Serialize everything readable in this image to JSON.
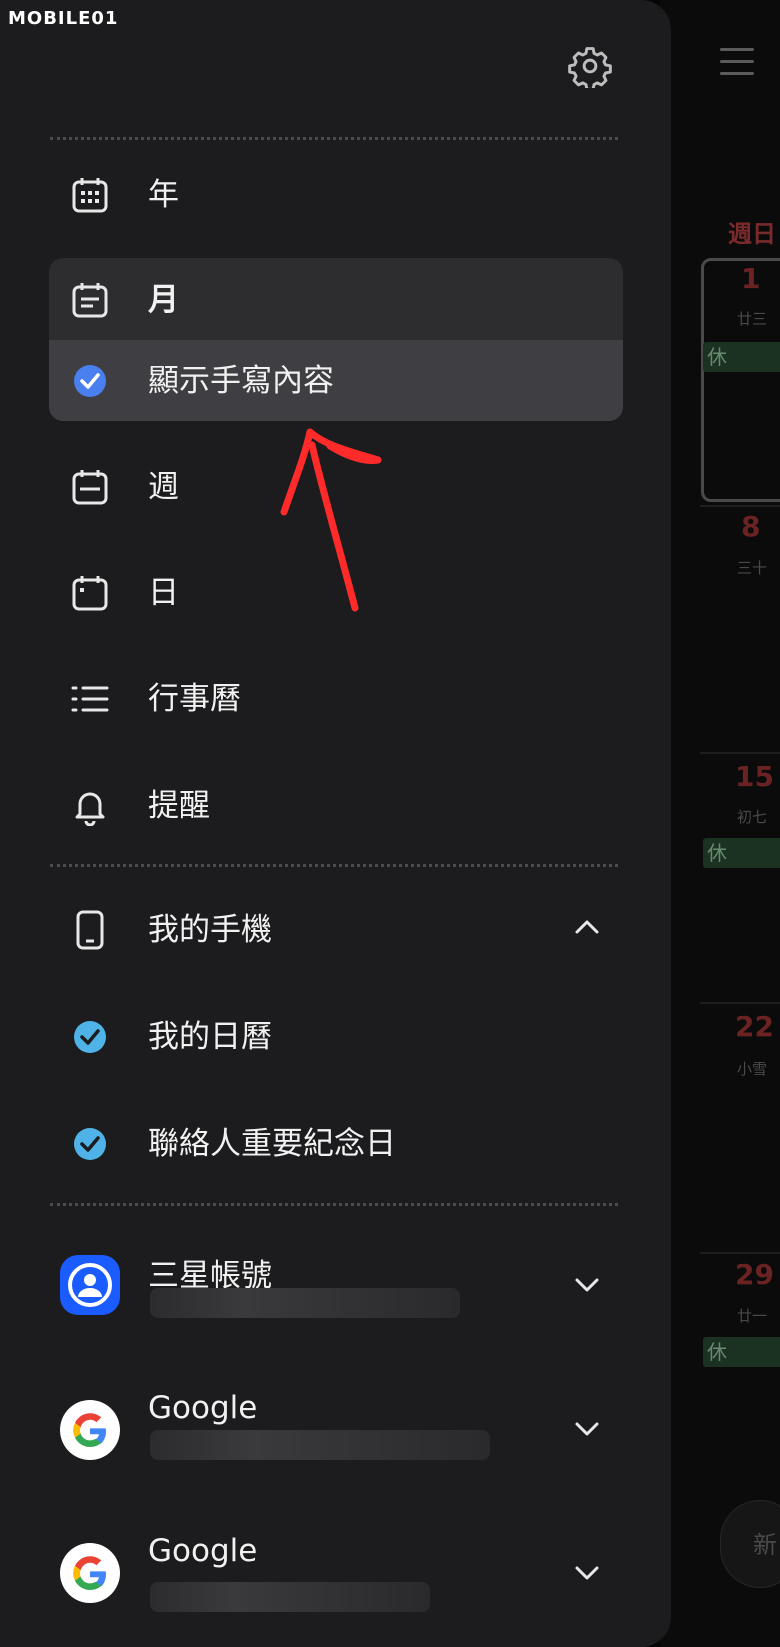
{
  "logo": {
    "text": "MOBILE01"
  },
  "drawer": {
    "view_items": [
      {
        "label": "年",
        "icon": "calendar-grid-icon"
      },
      {
        "label": "月",
        "icon": "calendar-month-icon",
        "selected": true
      },
      {
        "label": "顯示手寫內容",
        "icon": "check-circle-icon",
        "checked": true
      },
      {
        "label": "週",
        "icon": "calendar-week-icon"
      },
      {
        "label": "日",
        "icon": "calendar-day-icon"
      },
      {
        "label": "行事曆",
        "icon": "list-icon"
      },
      {
        "label": "提醒",
        "icon": "bell-icon"
      }
    ],
    "my_phone": {
      "label": "我的手機",
      "expanded": true,
      "calendars": [
        {
          "label": "我的日曆",
          "checked": true,
          "color": "#4fb3e8"
        },
        {
          "label": "聯絡人重要紀念日",
          "checked": true,
          "color": "#4fb3e8"
        }
      ]
    },
    "accounts": [
      {
        "label": "三星帳號",
        "icon": "samsung-account-icon"
      },
      {
        "label": "Google",
        "icon": "google-icon"
      },
      {
        "label": "Google",
        "icon": "google-icon"
      }
    ]
  },
  "background_calendar": {
    "weekday_label": "週日",
    "weeks": [
      {
        "day": "1",
        "lunar": "廿三",
        "holiday": "休"
      },
      {
        "day": "8",
        "lunar": "三十"
      },
      {
        "day": "15",
        "lunar": "初七",
        "holiday": "休"
      },
      {
        "day": "22",
        "lunar": "小雪"
      },
      {
        "day": "29",
        "lunar": "廿一",
        "holiday": "休"
      }
    ],
    "new_button": "新"
  },
  "colors": {
    "drawer_bg": "#1c1c1e",
    "selected_bg": "#2d2d30",
    "sub_selected_bg": "#3f3f43",
    "check_blue": "#4a7ff0",
    "check_cyan": "#4fb3e8",
    "annotation_red": "#ff2a2a"
  }
}
